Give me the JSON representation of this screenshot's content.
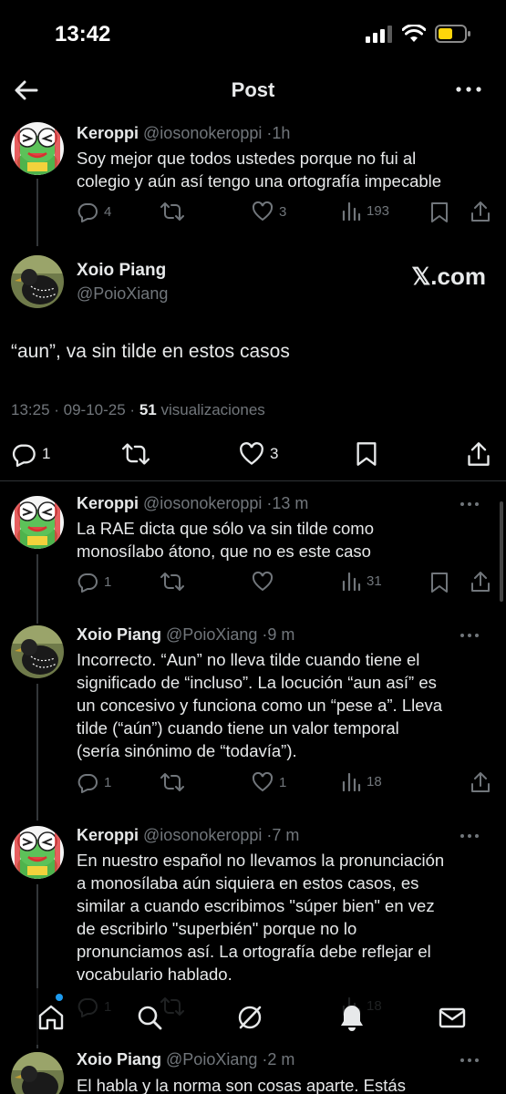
{
  "status": {
    "time": "13:42"
  },
  "nav": {
    "title": "Post"
  },
  "tweets": [
    {
      "name": "Keroppi",
      "handle": "@iosonokeroppi",
      "time": "1h",
      "text": "Soy mejor que todos ustedes porque no fui al\ncolegio y aún así tengo una ortografía impecable",
      "replies": "4",
      "retweets": "",
      "likes": "3",
      "views": "193"
    },
    {
      "name": "Keroppi",
      "handle": "@iosonokeroppi",
      "time": "13 m",
      "text": "La RAE dicta que sólo va sin tilde como\nmonosílabo átono, que no es este caso",
      "replies": "1",
      "retweets": "",
      "likes": "",
      "views": "31"
    },
    {
      "name": "Xoio Piang",
      "handle": "@PoioXiang",
      "time": "9 m",
      "text": "Incorrecto. “Aun” no lleva tilde cuando tiene el\nsignificado de “incluso”. La locución “aun así” es\nun concesivo y funciona como un “pese a”. Lleva\ntilde (“aún”) cuando tiene un valor temporal\n(sería sinónimo de “todavía”).",
      "replies": "1",
      "retweets": "",
      "likes": "1",
      "views": "18"
    },
    {
      "name": "Keroppi",
      "handle": "@iosonokeroppi",
      "time": "7 m",
      "text": "En nuestro español no llevamos la pronunciación\na monosílaba aún siquiera en estos casos, es\nsimilar a cuando escribimos \"súper bien\" en vez\nde escribirlo \"superbién\" porque no lo\npronunciamos así. La ortografía debe reflejar el\nvocabulario hablado.",
      "replies": "1",
      "retweets": "",
      "likes": "",
      "views": "18"
    },
    {
      "name": "Xoio Piang",
      "handle": "@PoioXiang",
      "time": "2 m",
      "text": "El habla y la norma son cosas aparte. Estás"
    }
  ],
  "main": {
    "name": "Xoio Piang",
    "handle": "@PoioXiang",
    "watermark": "𝕏.com",
    "text": "“aun”, va sin tilde en estos casos",
    "timestamp": "13:25 · 09-10-25 · ",
    "views_count": "51",
    "views_label": " visualizaciones",
    "replies": "1",
    "likes": "3"
  },
  "sep": "·",
  "colors": {
    "background": "#000000",
    "text": "#e7e9ea",
    "muted": "#71767b",
    "accent": "#1d9bf0",
    "divider": "#2f3336"
  },
  "icons": [
    "back-arrow-icon",
    "more-icon",
    "reply-icon",
    "retweet-icon",
    "like-icon",
    "views-icon",
    "bookmark-icon",
    "share-icon",
    "home-icon",
    "search-icon",
    "grok-icon",
    "notifications-icon",
    "messages-icon"
  ]
}
